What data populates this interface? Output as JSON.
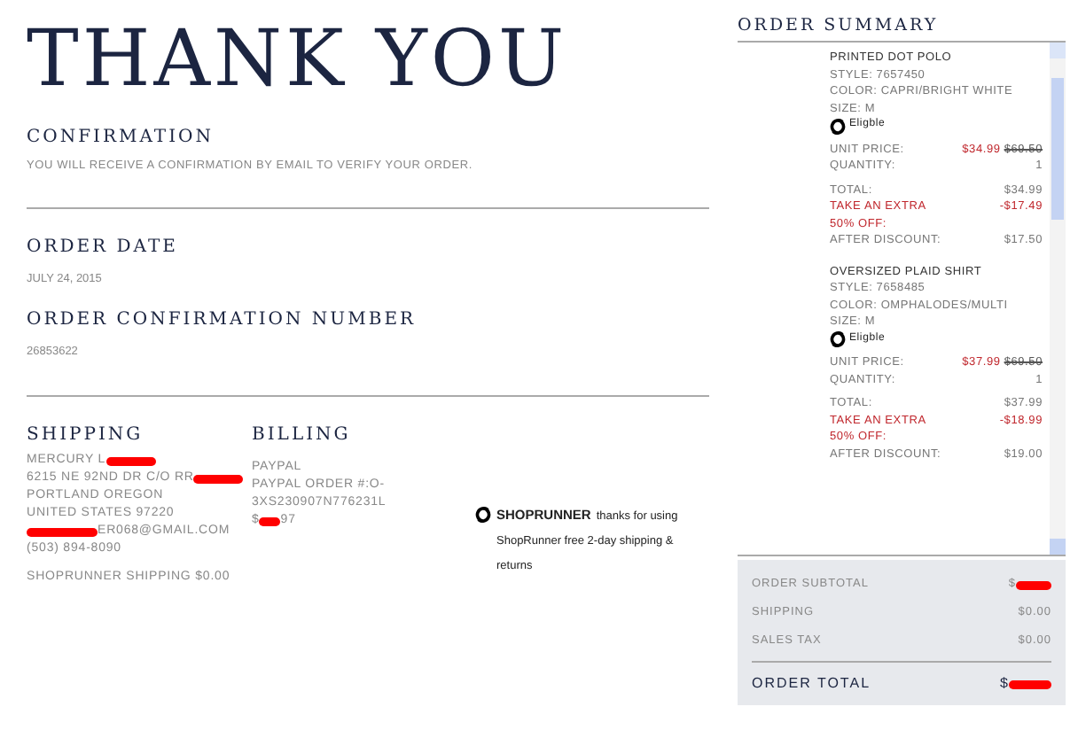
{
  "heading": "THANK YOU",
  "confirmation": {
    "title": "CONFIRMATION",
    "text": "YOU WILL RECEIVE A CONFIRMATION BY EMAIL TO VERIFY YOUR ORDER."
  },
  "order_date": {
    "title": "ORDER DATE",
    "value": "JULY 24, 2015"
  },
  "confirmation_number": {
    "title": "ORDER CONFIRMATION NUMBER",
    "value": "26853622"
  },
  "shipping": {
    "title": "SHIPPING",
    "lines": [
      {
        "text": "MERCURY L",
        "redacted": true
      },
      {
        "text": "6215 NE 92ND DR C/O RR",
        "redacted": true
      },
      {
        "text": "PORTLAND OREGON",
        "redacted": false
      },
      {
        "text": "UNITED STATES 97220",
        "redacted": false
      },
      {
        "after": "ER068@GMAIL.COM",
        "redacted": true
      },
      {
        "text": "(503) 894-8090",
        "redacted": false
      }
    ],
    "note": "SHOPRUNNER SHIPPING $0.00"
  },
  "billing": {
    "title": "BILLING",
    "lines": [
      {
        "text": "PAYPAL",
        "redacted": false
      },
      {
        "text": "PAYPAL ORDER #:O-3XS230907N776231L",
        "redacted": false
      },
      {
        "text": "$",
        "after": "97",
        "redacted": true
      }
    ]
  },
  "shoprunner": {
    "brand": "SHOPRUNNER",
    "text": "thanks for using ShopRunner free 2-day shipping & returns"
  },
  "order_summary": {
    "title": "ORDER SUMMARY",
    "items": [
      {
        "name": "PRINTED DOT POLO",
        "style": "STYLE: 7657450",
        "variant": "COLOR: CAPRI/BRIGHT WHITE",
        "size": "SIZE: M",
        "eligible": "Eligble",
        "unit_price_label": "UNIT PRICE:",
        "price": "$34.99",
        "original_price": "$69.50",
        "quantity_label": "QUANTITY:",
        "quantity": "1",
        "total_label": "TOTAL:",
        "total": "$34.99",
        "promo_label": "TAKE AN EXTRA 50% OFF:",
        "promo": "-$17.49",
        "after_label": "AFTER DISCOUNT:",
        "after": "$17.50"
      },
      {
        "name": "OVERSIZED PLAID SHIRT",
        "style": "STYLE: 7658485",
        "variant": "COLOR: OMPHALODES/MULTI",
        "size": "SIZE: M",
        "eligible": "Eligble",
        "unit_price_label": "UNIT PRICE:",
        "price": "$37.99",
        "original_price": "$69.50",
        "quantity_label": "QUANTITY:",
        "quantity": "1",
        "total_label": "TOTAL:",
        "total": "$37.99",
        "promo_label": "TAKE AN EXTRA 50% OFF:",
        "promo": "-$18.99",
        "after_label": "AFTER DISCOUNT:",
        "after": "$19.00"
      }
    ],
    "totals": [
      {
        "label": "ORDER SUBTOTAL",
        "value": "$",
        "redacted": true
      },
      {
        "label": "SHIPPING",
        "value": "$0.00",
        "redacted": false
      },
      {
        "label": "SALES TAX",
        "value": "$0.00",
        "redacted": false
      }
    ],
    "order_total": {
      "label": "ORDER TOTAL",
      "value": "$",
      "redacted": true
    }
  }
}
